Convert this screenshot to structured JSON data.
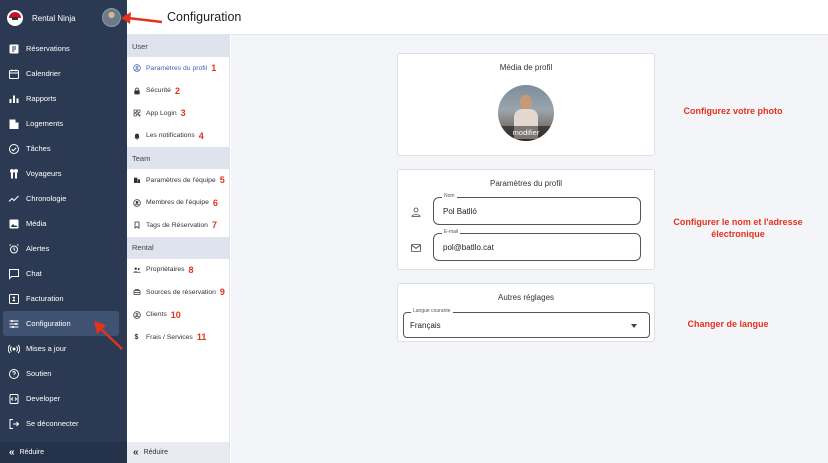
{
  "app": {
    "brand": "Rental Ninja",
    "page_title": "Configuration"
  },
  "sidebar": {
    "items": [
      {
        "label": "Réservations",
        "icon": "book-icon"
      },
      {
        "label": "Calendrier",
        "icon": "calendar-icon"
      },
      {
        "label": "Rapports",
        "icon": "bar-chart-icon"
      },
      {
        "label": "Logements",
        "icon": "building-icon"
      },
      {
        "label": "Tâches",
        "icon": "check-circle-icon"
      },
      {
        "label": "Voyageurs",
        "icon": "people-icon"
      },
      {
        "label": "Chronologie",
        "icon": "timeline-icon"
      },
      {
        "label": "Média",
        "icon": "image-icon"
      },
      {
        "label": "Alertes",
        "icon": "alarm-icon"
      },
      {
        "label": "Chat",
        "icon": "chat-icon"
      },
      {
        "label": "Facturation",
        "icon": "invoice-icon"
      },
      {
        "label": "Configuration",
        "icon": "sliders-icon",
        "active": true
      },
      {
        "label": "Mises a jour",
        "icon": "broadcast-icon"
      },
      {
        "label": "Soutien",
        "icon": "help-icon"
      },
      {
        "label": "Developer",
        "icon": "code-icon"
      },
      {
        "label": "Se déconnecter",
        "icon": "logout-icon"
      }
    ],
    "collapse_label": "Réduire"
  },
  "submenu": {
    "user_title": "User",
    "user_items": [
      {
        "label": "Paramètres du profil",
        "num": "1",
        "icon": "user-circle-icon"
      },
      {
        "label": "Sécurité",
        "num": "2",
        "icon": "lock-icon"
      },
      {
        "label": "App Login",
        "num": "3",
        "icon": "qr-icon"
      },
      {
        "label": "Les notifications",
        "num": "4",
        "icon": "bell-icon"
      }
    ],
    "team_title": "Team",
    "team_items": [
      {
        "label": "Paramètres de l'équipe",
        "num": "5",
        "icon": "building-icon"
      },
      {
        "label": "Membres de l'équipe",
        "num": "6",
        "icon": "team-icon"
      },
      {
        "label": "Tags de Réservation",
        "num": "7",
        "icon": "bookmark-icon"
      }
    ],
    "rental_title": "Rental",
    "rental_items": [
      {
        "label": "Propriétaires",
        "num": "8",
        "icon": "owners-icon"
      },
      {
        "label": "Sources de réservation",
        "num": "9",
        "icon": "source-icon"
      },
      {
        "label": "Clients",
        "num": "10",
        "icon": "client-icon"
      },
      {
        "label": "Frais / Services",
        "num": "11",
        "icon": "dollar-icon"
      }
    ],
    "collapse_label": "Réduire"
  },
  "media": {
    "title": "Média de profil",
    "edit_label": "modifier"
  },
  "profile": {
    "title": "Paramètres du profil",
    "name_label": "Nom",
    "name_value": "Pol Batlló",
    "email_label": "E-mail",
    "email_value": "pol@batllo.cat"
  },
  "other": {
    "title": "Autres réglages",
    "language_label": "Langue courante",
    "language_value": "Français"
  },
  "notes": {
    "photo": "Configurez votre photo",
    "name_email": "Configurer le nom et l'adresse électronique",
    "language": "Changer de langue"
  },
  "colors": {
    "sidebar": "#2b3a52",
    "accent": "#4063b7",
    "annotation": "#e3321e"
  }
}
